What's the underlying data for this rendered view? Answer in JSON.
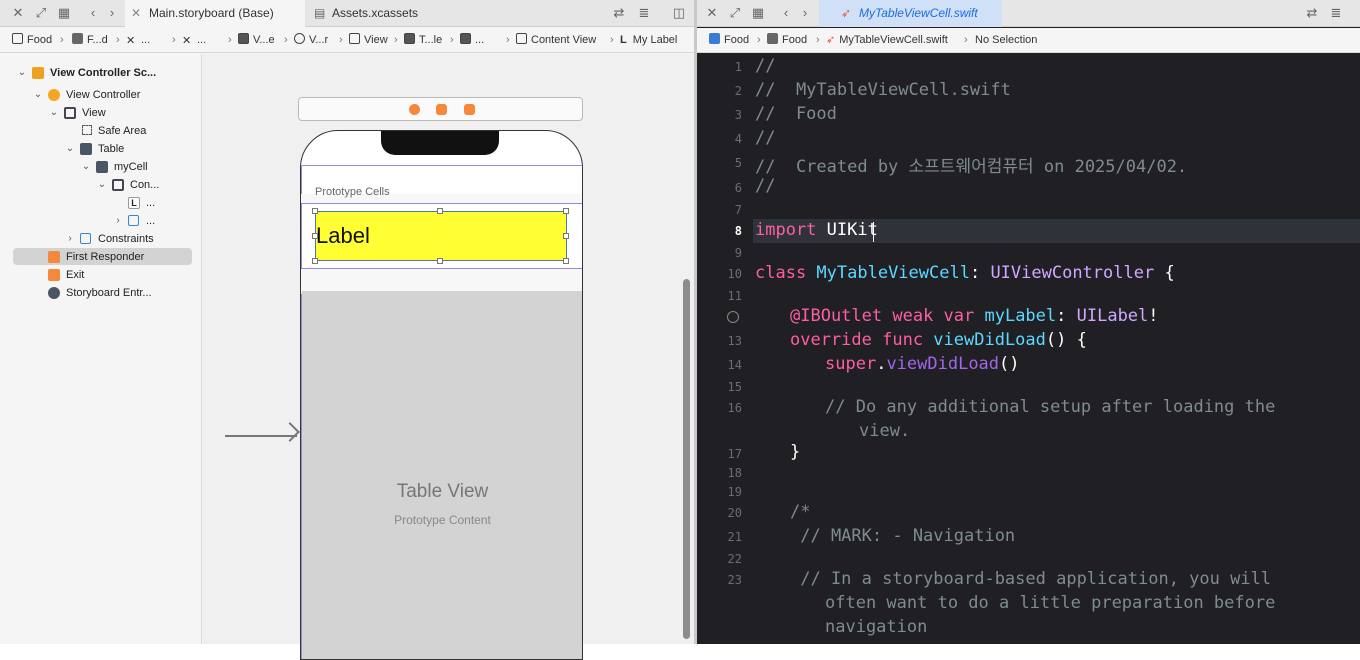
{
  "left": {
    "tabs": [
      {
        "label": "Main.storyboard (Base)"
      },
      {
        "label": "Assets.xcassets"
      }
    ],
    "jumpbar": {
      "items": [
        {
          "label": "Food"
        },
        {
          "label": "F...d"
        },
        {
          "label": "..."
        },
        {
          "label": "..."
        },
        {
          "label": "V...e"
        },
        {
          "label": "V...r"
        },
        {
          "label": "View"
        },
        {
          "label": "T...le"
        },
        {
          "label": "..."
        },
        {
          "label": "Content View"
        },
        {
          "label": "My Label"
        }
      ]
    },
    "outline": [
      {
        "label": "View Controller Sc..."
      },
      {
        "label": "View Controller"
      },
      {
        "label": "View"
      },
      {
        "label": "Safe Area"
      },
      {
        "label": "Table"
      },
      {
        "label": "myCell"
      },
      {
        "label": "Con..."
      },
      {
        "label": "..."
      },
      {
        "label": "..."
      },
      {
        "label": "Constraints"
      },
      {
        "label": "First Responder"
      },
      {
        "label": "Exit"
      },
      {
        "label": "Storyboard Entr..."
      }
    ],
    "canvas": {
      "prototype_cells": "Prototype Cells",
      "cell_label": "Label",
      "table_view_title": "Table View",
      "table_view_subtitle": "Prototype Content"
    }
  },
  "right": {
    "tab": {
      "label": "MyTableViewCell.swift"
    },
    "jumpbar": [
      {
        "label": "Food"
      },
      {
        "label": "Food"
      },
      {
        "label": "MyTableViewCell.swift"
      },
      {
        "label": "No Selection"
      }
    ],
    "lines": [
      {
        "n": "1",
        "text": "//"
      },
      {
        "n": "2",
        "text": "//  MyTableViewCell.swift"
      },
      {
        "n": "3",
        "text": "//  Food"
      },
      {
        "n": "4",
        "text": "//"
      },
      {
        "n": "5",
        "text": "//  Created by 소프트웨어컴퓨터 on 2025/04/02."
      },
      {
        "n": "6",
        "text": "//"
      },
      {
        "n": "7",
        "text": ""
      },
      {
        "n": "8",
        "kw": "import",
        "rest": " UIKit"
      },
      {
        "n": "9",
        "text": ""
      },
      {
        "n": "10",
        "kw": "class",
        "name": " MyTableViewCell",
        "p1": ":",
        "type": " UIViewController",
        "p2": " {"
      },
      {
        "n": "11",
        "text": ""
      },
      {
        "n": "12",
        "attr": "@IBOutlet",
        "kw": " weak var",
        "name": " myLabel",
        "p1": ":",
        "type": " UILabel",
        "p2": "!"
      },
      {
        "n": "13",
        "kw": "override func",
        "name": " viewDidLoad",
        "p1": "() {"
      },
      {
        "n": "14",
        "kw": "super",
        "p1": ".",
        "fn": "viewDidLoad",
        "p2": "()"
      },
      {
        "n": "15",
        "text": ""
      },
      {
        "n": "16",
        "text": "// Do any additional setup after loading the",
        "cont": "view."
      },
      {
        "n": "17",
        "text": "}"
      },
      {
        "n": "18",
        "text": ""
      },
      {
        "n": "19",
        "text": ""
      },
      {
        "n": "20",
        "text": "/*"
      },
      {
        "n": "21",
        "text": " // MARK: - Navigation"
      },
      {
        "n": "22",
        "text": ""
      },
      {
        "n": "23",
        "text": " // In a storyboard-based application, you will",
        "cont": "often want to do a little preparation before",
        "cont2": "navigation"
      }
    ]
  }
}
